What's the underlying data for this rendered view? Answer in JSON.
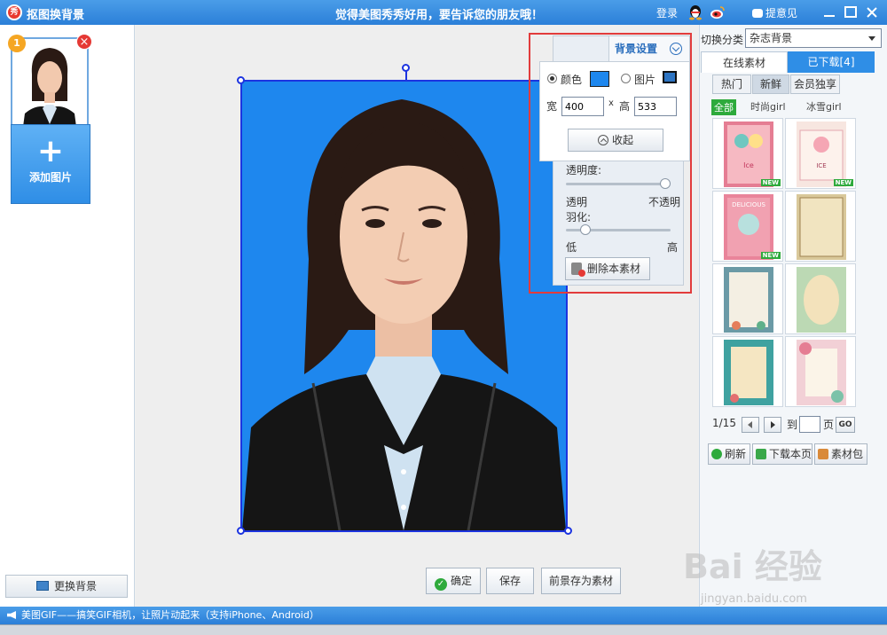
{
  "titlebar": {
    "title": "抠图换背景",
    "slogan": "觉得美图秀秀好用，要告诉您的朋友哦！",
    "login": "登录",
    "feedback": "提意见"
  },
  "left": {
    "thumb_index": "1",
    "add_label": "添加图片",
    "add_plus": "+",
    "change_bg_label": "更换背景"
  },
  "bg_settings": {
    "header": "背景设置",
    "color_label": "颜色",
    "image_label": "图片",
    "selected_mode": "颜色",
    "swatch_color": "#1e87ee",
    "width_label": "宽",
    "x_label": "x",
    "height_label": "高",
    "width_value": "400",
    "height_value": "533",
    "collapse_label": "收起",
    "opacity_label": "透明度:",
    "opacity_min": "透明",
    "opacity_max": "不透明",
    "opacity_value": 1.0,
    "feather_label": "羽化:",
    "feather_min": "低",
    "feather_max": "高",
    "feather_value": 0.15,
    "delete_label": "删除本素材"
  },
  "canvas": {
    "bg_color": "#1e87ee",
    "confirm_label": "确定",
    "save_label": "保存",
    "save_fg_label": "前景存为素材"
  },
  "right": {
    "category_label": "切换分类",
    "category_value": "杂志背景",
    "tabs": [
      "在线素材",
      "已下载[4]"
    ],
    "subtabs": [
      "热门",
      "新鲜",
      "会员独享"
    ],
    "filters": [
      "全部",
      "时尚girl",
      "冰雪girl"
    ],
    "new_badge": "NEW",
    "pager_text": "1/15",
    "goto_label": "到",
    "page_label": "页",
    "go_label": "GO",
    "refresh_label": "刷新",
    "download_label": "下载本页",
    "pack_label": "素材包"
  },
  "statusbar": {
    "text": "美图GIF——搞笑GIF相机，让照片动起来（支持iPhone、Android）"
  },
  "watermark": {
    "logo": "Bai 经验",
    "url": "jingyan.baidu.com"
  },
  "icons": [
    "app-logo-icon",
    "qq-icon",
    "weibo-icon",
    "feedback-icon",
    "minimize-icon",
    "maximize-icon",
    "close-icon",
    "chevron-down-icon",
    "image-icon",
    "collapse-up-icon",
    "trash-icon",
    "prev-page-icon",
    "next-page-icon",
    "refresh-icon",
    "download-icon",
    "package-icon",
    "speaker-icon"
  ]
}
